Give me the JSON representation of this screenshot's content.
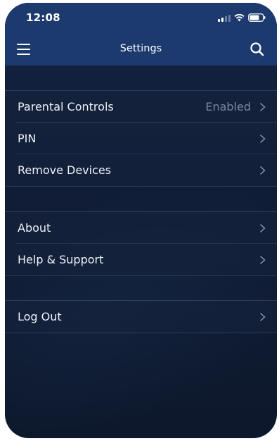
{
  "status_bar": {
    "time": "12:08"
  },
  "nav": {
    "title": "Settings",
    "menu_icon": "hamburger-menu-icon",
    "search_icon": "search-icon"
  },
  "groups": [
    {
      "items": [
        {
          "label": "Parental Controls",
          "value": "Enabled"
        },
        {
          "label": "PIN",
          "value": ""
        },
        {
          "label": "Remove Devices",
          "value": ""
        }
      ]
    },
    {
      "items": [
        {
          "label": "About",
          "value": ""
        },
        {
          "label": "Help & Support",
          "value": ""
        }
      ]
    },
    {
      "items": [
        {
          "label": "Log Out",
          "value": ""
        }
      ]
    }
  ],
  "colors": {
    "header": "#1d3a6f",
    "background": "#101d35",
    "text": "#eef2f8",
    "secondary_text": "#7d889c"
  }
}
